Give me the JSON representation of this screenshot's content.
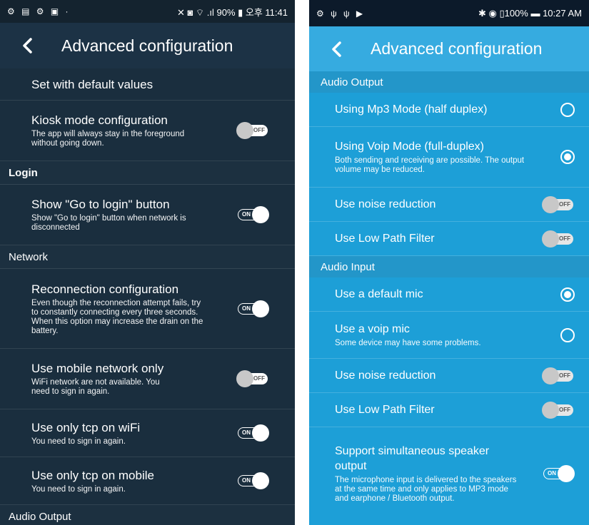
{
  "left": {
    "status": {
      "icons": "⚙ ▤ ⚙ ▣ ·",
      "right": "✕ ◙ ⌔ .ıl 90% ▮ 오후 11:41"
    },
    "title": "Advanced configuration",
    "items": [
      {
        "type": "row",
        "title": "Set with default values"
      },
      {
        "type": "row",
        "title": "Kiosk mode configuration",
        "sub": "The app will always stay in the foreground without going down.",
        "toggle": "OFF"
      },
      {
        "type": "section",
        "title": "Login"
      },
      {
        "type": "row",
        "title": "Show \"Go to login\" button",
        "sub": "Show \"Go to login\" button when network is disconnected",
        "toggle": "ON"
      },
      {
        "type": "section",
        "title": "Network"
      },
      {
        "type": "row",
        "title": "Reconnection configuration",
        "sub": "Even though the reconnection attempt fails, try to constantly connecting every three seconds. When this option may increase the drain on the battery.",
        "toggle": "ON"
      },
      {
        "type": "row",
        "title": "Use mobile network only",
        "sub": "WiFi network are not available. You need to sign in again.",
        "toggle": "OFF"
      },
      {
        "type": "row",
        "title": "Use only tcp on wiFi",
        "sub": "You need to sign in again.",
        "toggle": "ON"
      },
      {
        "type": "row",
        "title": "Use only tcp on mobile",
        "sub": "You need to sign in again.",
        "toggle": "ON"
      },
      {
        "type": "section",
        "title": "Audio Output"
      }
    ]
  },
  "right": {
    "status": {
      "icons": "⚙ ψ ψ ▶",
      "right": "✱ ◉ ▯100% ▬ 10:27 AM"
    },
    "title": "Advanced configuration",
    "items": [
      {
        "type": "section",
        "title": "Audio Output"
      },
      {
        "type": "row",
        "title": "Using Mp3 Mode (half duplex)",
        "radio": false
      },
      {
        "type": "row",
        "title": "Using Voip Mode (full-duplex)",
        "sub": "Both sending and receiving are possible. The output volume may be reduced.",
        "radio": true
      },
      {
        "type": "row",
        "title": "Use noise reduction",
        "toggle": "OFF"
      },
      {
        "type": "row",
        "title": "Use Low Path Filter",
        "toggle": "OFF"
      },
      {
        "type": "section",
        "title": "Audio Input"
      },
      {
        "type": "row",
        "title": "Use a default mic",
        "radio": true
      },
      {
        "type": "row",
        "title": "Use a voip mic",
        "sub": "Some device may have some problems.",
        "radio": false
      },
      {
        "type": "row",
        "title": "Use noise reduction",
        "toggle": "OFF"
      },
      {
        "type": "row",
        "title": "Use Low Path Filter",
        "toggle": "OFF"
      },
      {
        "type": "row",
        "title": "Support simultaneous speaker output",
        "sub": "The microphone input is delivered to the speakers at the same time and only applies to MP3 mode and earphone / Bluetooth output.",
        "toggle": "ON"
      }
    ]
  },
  "colors": {
    "left_bg": "#1a2e3e",
    "right_bg": "#1d9fd7",
    "right_bar": "#36abe0"
  }
}
